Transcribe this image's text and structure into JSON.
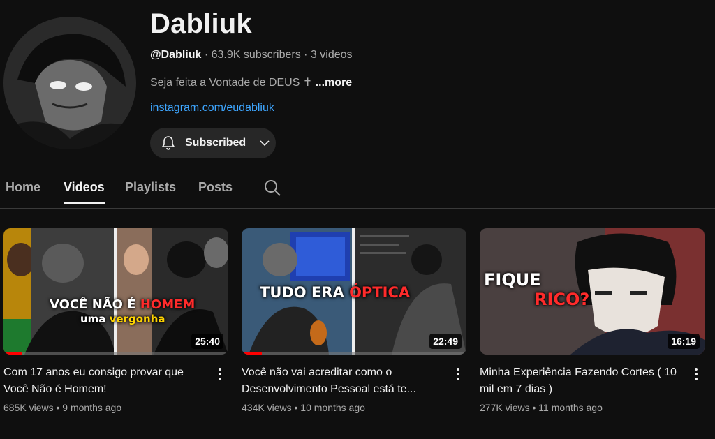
{
  "channel": {
    "name": "Dabliuk",
    "handle": "@Dabliuk",
    "subscribers": "63.9K subscribers",
    "videos_count": "3 videos",
    "sep": "·",
    "description": "Seja feita a Vontade de DEUS ✝",
    "more_label": "...more",
    "link": "instagram.com/eudabliuk",
    "subscribe_label": "Subscribed",
    "icons": {
      "bell": "bell-icon",
      "chevron": "chevron-down-icon"
    }
  },
  "tabs": [
    {
      "label": "Home"
    },
    {
      "label": "Videos",
      "active": true
    },
    {
      "label": "Playlists"
    },
    {
      "label": "Posts"
    }
  ],
  "videos": [
    {
      "title": "Com 17 anos eu consigo provar que Você Não é Homem!",
      "views": "685K views",
      "age": "9 months ago",
      "duration": "25:40",
      "progress": 0.08,
      "thumb_text_1a": "VOCÊ NÃO É ",
      "thumb_text_1b": "HOMEM",
      "thumb_text_2a": "uma ",
      "thumb_text_2b": "vergonha"
    },
    {
      "title": "Você não vai acreditar como o Desenvolvimento Pessoal está te...",
      "views": "434K views",
      "age": "10 months ago",
      "duration": "22:49",
      "progress": 0.09,
      "thumb_text_1a": "TUDO ERA ",
      "thumb_text_1b": "ÓPTICA"
    },
    {
      "title": "Minha Experiência Fazendo Cortes ( 10 mil em 7 dias )",
      "views": "277K views",
      "age": "11 months ago",
      "duration": "16:19",
      "thumb_text_1a": "FIQUE",
      "thumb_text_1b": "RICO?"
    }
  ],
  "colors": {
    "background": "#0f0f0f",
    "link": "#3ea6ff",
    "accent_red": "#ff0000"
  }
}
